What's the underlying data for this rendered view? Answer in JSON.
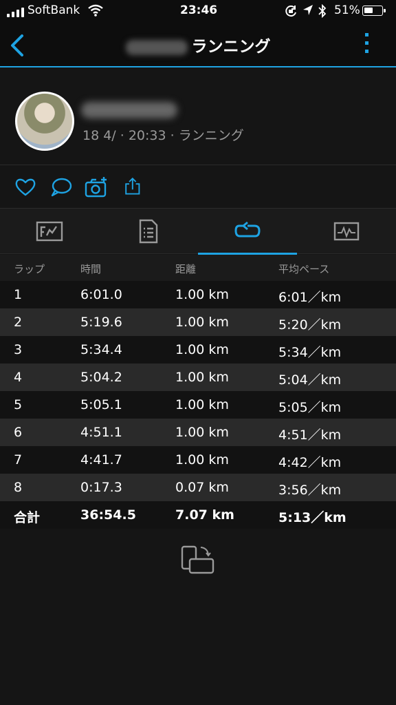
{
  "status_bar": {
    "carrier": "SoftBank",
    "time": "23:46",
    "battery_percent": "51%",
    "battery_level": 0.51
  },
  "nav": {
    "title": "ランニング"
  },
  "activity": {
    "meta": "18 4/  · 20:33 · ランニング"
  },
  "table": {
    "headers": [
      "ラップ",
      "時間",
      "距離",
      "平均ペース"
    ],
    "rows": [
      [
        "1",
        "6:01.0",
        "1.00 km",
        "6:01／km"
      ],
      [
        "2",
        "5:19.6",
        "1.00 km",
        "5:20／km"
      ],
      [
        "3",
        "5:34.4",
        "1.00 km",
        "5:34／km"
      ],
      [
        "4",
        "5:04.2",
        "1.00 km",
        "5:04／km"
      ],
      [
        "5",
        "5:05.1",
        "1.00 km",
        "5:05／km"
      ],
      [
        "6",
        "4:51.1",
        "1.00 km",
        "4:51／km"
      ],
      [
        "7",
        "4:41.7",
        "1.00 km",
        "4:42／km"
      ],
      [
        "8",
        "0:17.3",
        "0.07 km",
        "3:56／km"
      ]
    ],
    "total": [
      "合計",
      "36:54.5",
      "7.07 km",
      "5:13／km"
    ]
  },
  "colors": {
    "accent": "#1ea3e3",
    "background": "#151515",
    "row_alt": "#2a2a2a"
  }
}
